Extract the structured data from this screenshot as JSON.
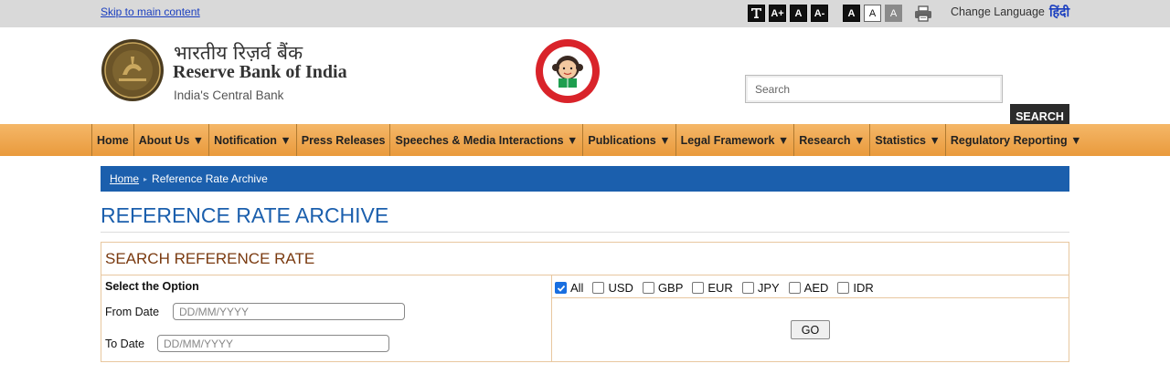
{
  "topbar": {
    "skip_link": "Skip to main content",
    "text_size_buttons": [
      "A+",
      "A",
      "A-"
    ],
    "contrast_buttons": [
      "A",
      "A",
      "A"
    ],
    "change_language": "Change Language",
    "hindi": "हिंदी",
    "icons": [
      "text-mode-icon",
      "printer-icon"
    ]
  },
  "header": {
    "brand_hindi": "भारतीय रिज़र्व बैंक",
    "brand_english": "Reserve Bank of India",
    "tagline": "India's Central Bank",
    "search_placeholder": "Search",
    "search_button": "SEARCH"
  },
  "nav": {
    "items": [
      "Home",
      "About Us ▼",
      "Notification ▼",
      "Press Releases",
      "Speeches & Media Interactions ▼",
      "Publications ▼",
      "Legal Framework ▼",
      "Research ▼",
      "Statistics ▼",
      "Regulatory Reporting ▼"
    ]
  },
  "breadcrumb": {
    "home": "Home",
    "current": "Reference Rate Archive"
  },
  "page_title": "REFERENCE RATE ARCHIVE",
  "search_box": {
    "title": "SEARCH REFERENCE RATE",
    "select_label": "Select the Option",
    "options": [
      {
        "label": "All",
        "checked": true
      },
      {
        "label": "USD",
        "checked": false
      },
      {
        "label": "GBP",
        "checked": false
      },
      {
        "label": "EUR",
        "checked": false
      },
      {
        "label": "JPY",
        "checked": false
      },
      {
        "label": "AED",
        "checked": false
      },
      {
        "label": "IDR",
        "checked": false
      }
    ],
    "from_label": "From Date",
    "to_label": "To Date",
    "date_placeholder": "DD/MM/YYYY",
    "go_button": "GO"
  },
  "colors": {
    "nav_orange": "#e99a3c",
    "breadcrumb_blue": "#1b5fad",
    "title_blue": "#1b5fad",
    "box_title_brown": "#7a3a10"
  }
}
